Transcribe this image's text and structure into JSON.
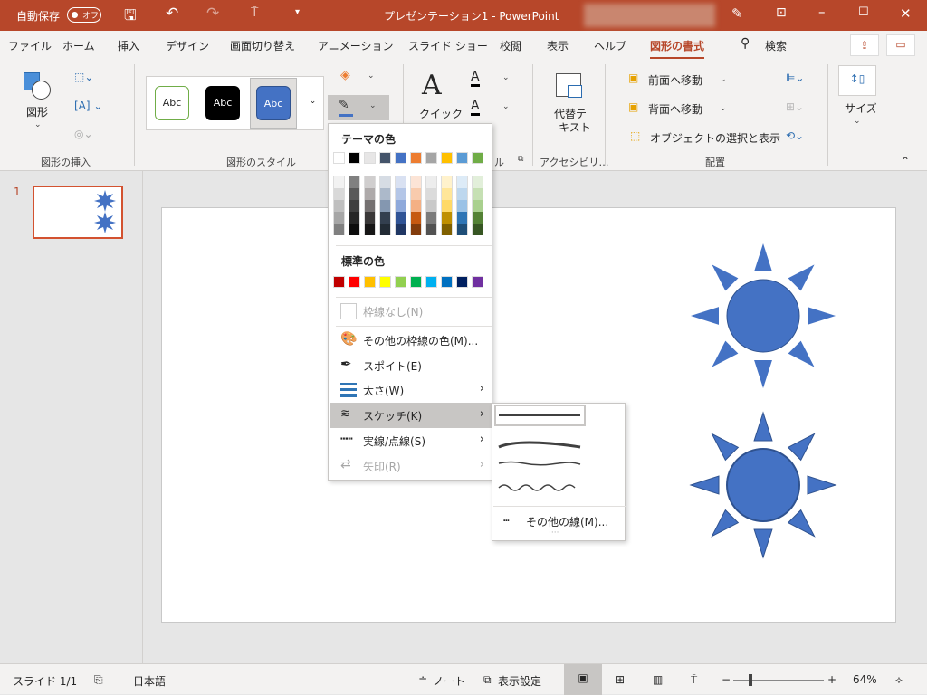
{
  "titlebar": {
    "autosave_label": "自動保存",
    "autosave_state": "オフ",
    "title": "プレゼンテーション1 - PowerPoint",
    "bg_color": "#B7472A"
  },
  "tabs": [
    {
      "label": "ファイル"
    },
    {
      "label": "ホーム"
    },
    {
      "label": "挿入"
    },
    {
      "label": "デザイン"
    },
    {
      "label": "画面切り替え"
    },
    {
      "label": "アニメーション"
    },
    {
      "label": "スライド ショー"
    },
    {
      "label": "校閲"
    },
    {
      "label": "表示"
    },
    {
      "label": "ヘルプ"
    },
    {
      "label": "図形の書式",
      "active": true
    },
    {
      "label": "検索"
    }
  ],
  "ribbon": {
    "insert_shapes": {
      "shapes_label": "図形",
      "group_label": "図形の挿入"
    },
    "shape_styles": {
      "samples": [
        "Abc",
        "Abc",
        "Abc"
      ],
      "group_label": "図形のスタイル"
    },
    "wordart": {
      "quick_styles_label": "クイック",
      "group_label_partial": "ル"
    },
    "accessibility": {
      "alt_text_label_1": "代替テ",
      "alt_text_label_2": "キスト",
      "group_label": "アクセシビリ…"
    },
    "arrange": {
      "bring_forward": "前面へ移動",
      "send_backward": "背面へ移動",
      "selection_pane": "オブジェクトの選択と表示",
      "group_label": "配置"
    },
    "size": {
      "label": "サイズ"
    }
  },
  "outline_menu": {
    "theme_colors_header": "テーマの色",
    "theme_colors": [
      "#FFFFFF",
      "#000000",
      "#E7E6E6",
      "#44546A",
      "#4472C4",
      "#ED7D31",
      "#A5A5A5",
      "#FFC000",
      "#5B9BD5",
      "#70AD47"
    ],
    "theme_shades": [
      [
        "#F2F2F2",
        "#D9D9D9",
        "#BFBFBF",
        "#A6A6A6",
        "#808080"
      ],
      [
        "#808080",
        "#595959",
        "#404040",
        "#262626",
        "#0D0D0D"
      ],
      [
        "#D0CECE",
        "#AEAAAA",
        "#757171",
        "#3A3838",
        "#171616"
      ],
      [
        "#D6DCE4",
        "#ACB9CA",
        "#8497B0",
        "#333F4F",
        "#222B35"
      ],
      [
        "#D9E1F2",
        "#B4C6E7",
        "#8EA9DB",
        "#305496",
        "#203764"
      ],
      [
        "#FCE4D6",
        "#F8CBAD",
        "#F4B084",
        "#C65911",
        "#833C0C"
      ],
      [
        "#EDEDED",
        "#DBDBDB",
        "#C9C9C9",
        "#7B7B7B",
        "#525252"
      ],
      [
        "#FFF2CC",
        "#FFE699",
        "#FFD966",
        "#BF8F00",
        "#806000"
      ],
      [
        "#DDEBF7",
        "#BDD7EE",
        "#9BC2E6",
        "#2F75B5",
        "#1F4E78"
      ],
      [
        "#E2EFDA",
        "#C6E0B4",
        "#A9D08E",
        "#548235",
        "#375623"
      ]
    ],
    "standard_colors_header": "標準の色",
    "standard_colors": [
      "#C00000",
      "#FF0000",
      "#FFC000",
      "#FFFF00",
      "#92D050",
      "#00B050",
      "#00B0F0",
      "#0070C0",
      "#002060",
      "#7030A0"
    ],
    "items": [
      {
        "label": "枠線なし(N)",
        "disabled": true
      },
      {
        "label": "その他の枠線の色(M)..."
      },
      {
        "label": "スポイト(E)"
      },
      {
        "label": "太さ(W)"
      },
      {
        "label": "スケッチ(K)",
        "highlighted": true
      },
      {
        "label": "実線/点線(S)"
      },
      {
        "label": "矢印(R)",
        "disabled": true
      }
    ]
  },
  "sketch_submenu": {
    "more_lines": "その他の線(M)..."
  },
  "thumbnails": [
    {
      "number": "1"
    }
  ],
  "shape_color": "#4472C4",
  "status": {
    "slide": "スライド 1/1",
    "language": "日本語",
    "notes": "ノート",
    "display_settings": "表示設定",
    "zoom": "64%",
    "zoom_level_percent": 64
  }
}
